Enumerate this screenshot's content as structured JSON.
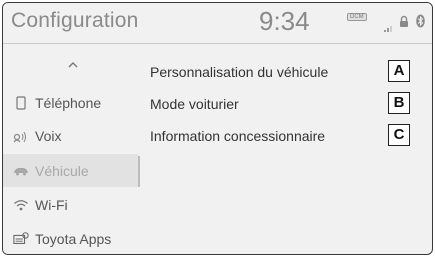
{
  "header": {
    "title": "Configuration",
    "clock": "9:34",
    "dcm_badge": "DCM",
    "status_icons": [
      "signal-icon",
      "lock-icon",
      "bluetooth-icon"
    ]
  },
  "sidebar": {
    "scroll_up_icon": "chevron-up-icon",
    "items": [
      {
        "label": "Téléphone",
        "icon": "phone-icon",
        "selected": false
      },
      {
        "label": "Voix",
        "icon": "voice-icon",
        "selected": false
      },
      {
        "label": "Véhicule",
        "icon": "car-icon",
        "selected": true
      },
      {
        "label": "Wi-Fi",
        "icon": "wifi-icon",
        "selected": false
      },
      {
        "label": "Toyota Apps",
        "icon": "apps-icon",
        "selected": false
      }
    ]
  },
  "main": {
    "items": [
      {
        "label": "Personnalisation du véhicule",
        "callout": "A"
      },
      {
        "label": "Mode voiturier",
        "callout": "B"
      },
      {
        "label": "Information concessionnaire",
        "callout": "C"
      }
    ]
  },
  "colors": {
    "screen_bg": "#f1f1f1",
    "header_text": "#8a8a8a",
    "selected_bg": "#e2e2e2"
  }
}
